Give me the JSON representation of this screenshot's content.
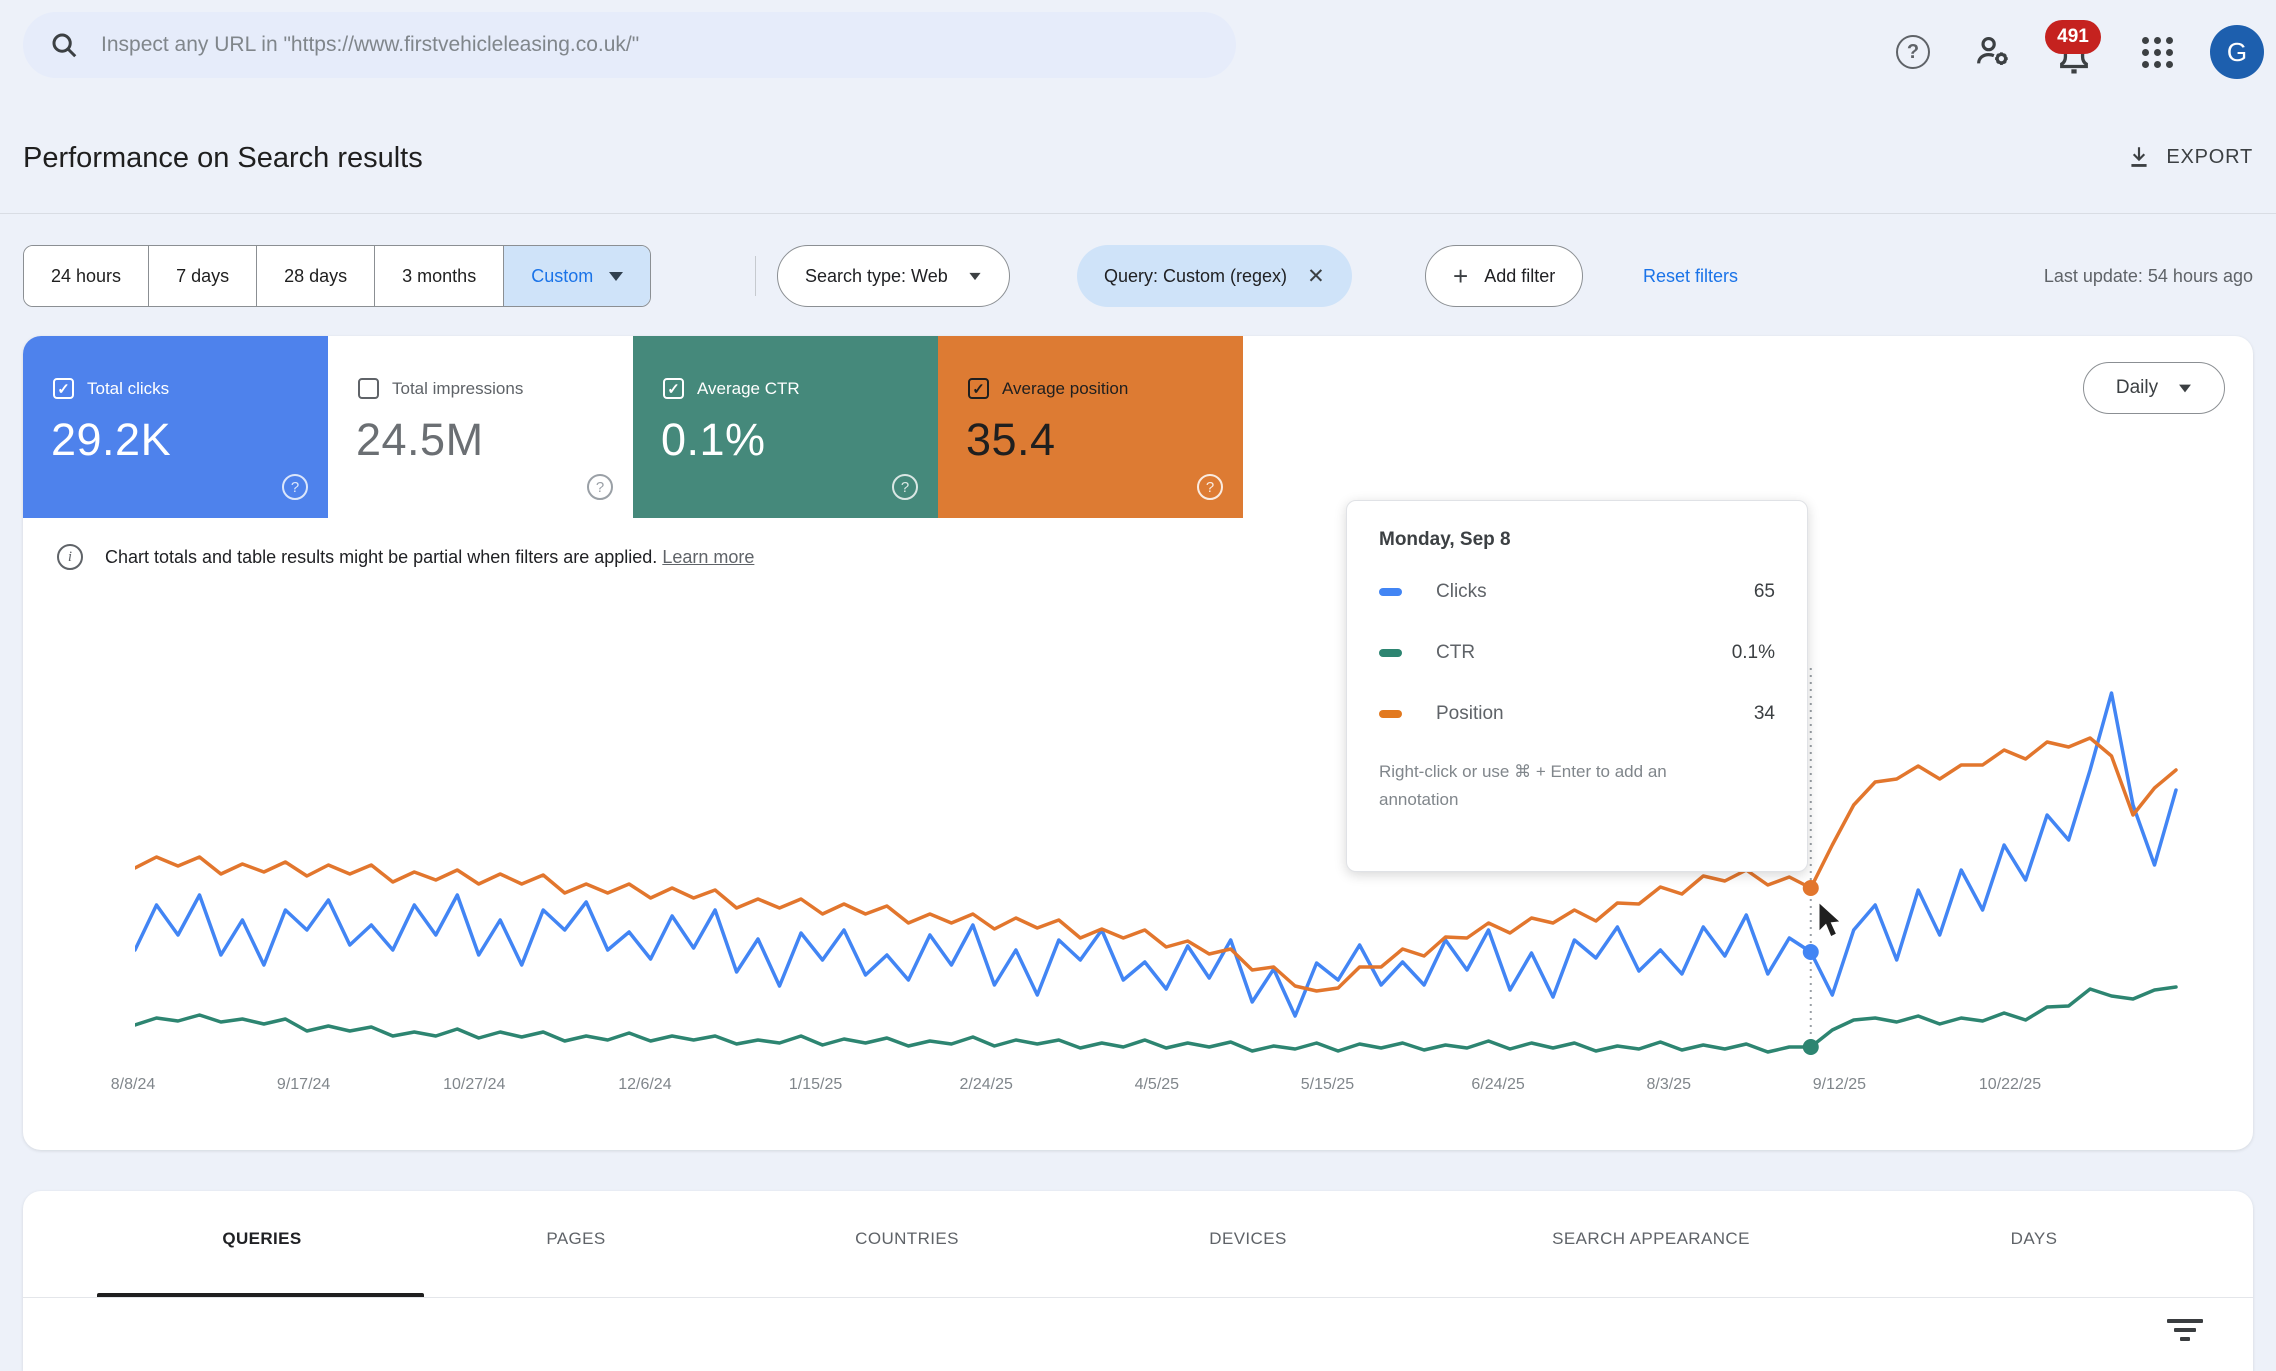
{
  "topbar": {
    "search_placeholder": "Inspect any URL in \"https://www.firstvehicleleasing.co.uk/\"",
    "notification_count": "491",
    "avatar_letter": "G"
  },
  "header": {
    "title": "Performance on Search results",
    "export_label": "EXPORT"
  },
  "filters": {
    "ranges": [
      "24 hours",
      "7 days",
      "28 days",
      "3 months"
    ],
    "custom_label": "Custom",
    "search_type_chip": "Search type: Web",
    "query_chip": "Query: Custom (regex)",
    "add_filter_label": "Add filter",
    "reset_label": "Reset filters",
    "last_update": "Last update: 54 hours ago"
  },
  "metrics": {
    "cards": [
      {
        "label": "Total clicks",
        "value": "29.2K",
        "checked": true,
        "bg": "#4e82ec",
        "fg": "#ffffff",
        "label_fg": "#ffffff",
        "help_fg": "rgba(255,255,255,0.8)"
      },
      {
        "label": "Total impressions",
        "value": "24.5M",
        "checked": false,
        "bg": "#ffffff",
        "fg": "#6b6f73",
        "label_fg": "#5f6368",
        "help_fg": "#9aa0a6"
      },
      {
        "label": "Average CTR",
        "value": "0.1%",
        "checked": true,
        "bg": "#45897b",
        "fg": "#ffffff",
        "label_fg": "#ffffff",
        "help_fg": "rgba(255,255,255,0.8)"
      },
      {
        "label": "Average position",
        "value": "35.4",
        "checked": true,
        "bg": "#dd7b33",
        "fg": "#1f1f1f",
        "label_fg": "#1f1f1f",
        "help_fg": "rgba(255,255,255,0.85)"
      }
    ]
  },
  "granularity": {
    "label": "Daily"
  },
  "notice": {
    "text": "Chart totals and table results might be partial when filters are applied.",
    "link_label": "Learn more"
  },
  "tooltip": {
    "title": "Monday, Sep 8",
    "rows": [
      {
        "label": "Clicks",
        "value": "65",
        "color": "#4285f4"
      },
      {
        "label": "CTR",
        "value": "0.1%",
        "color": "#2d8571"
      },
      {
        "label": "Position",
        "value": "34",
        "color": "#e2791f"
      }
    ],
    "footer": "Right-click or use ⌘ + Enter to add an annotation"
  },
  "chart_data": {
    "type": "line",
    "x_labels": [
      "8/8/24",
      "9/17/24",
      "10/27/24",
      "12/6/24",
      "1/15/25",
      "2/24/25",
      "4/5/25",
      "5/15/25",
      "6/24/25",
      "8/3/25",
      "9/12/25",
      "10/22/25"
    ],
    "grid": false,
    "legend_position": "none",
    "highlight_index": 78,
    "highlight_date": "Monday, Sep 8",
    "highlight_values": {
      "clicks": 65,
      "ctr_pct": 0.1,
      "position": 34
    },
    "series": [
      {
        "name": "Clicks",
        "color": "#4285f4",
        "values": [
          320,
          275,
          305,
          265,
          325,
          290,
          335,
          280,
          300,
          270,
          315,
          295,
          320,
          275,
          305,
          265,
          325,
          290,
          335,
          280,
          300,
          272,
          320,
          302,
          329,
          286,
          318,
          280,
          342,
          309,
          356,
          303,
          330,
          300,
          345,
          325,
          350,
          305,
          335,
          295,
          355,
          320,
          365,
          310,
          330,
          300,
          350,
          332,
          359,
          316,
          348,
          310,
          372,
          339,
          386,
          333,
          350,
          315,
          355,
          332,
          355,
          310,
          340,
          300,
          360,
          323,
          367,
          310,
          328,
          297,
          341,
          320,
          344,
          297,
          326,
          285,
          344,
          308,
          322,
          365,
          300,
          275,
          330,
          260,
          305,
          240,
          280,
          215,
          250,
          185,
          210,
          140,
          63,
          175,
          235,
          160
        ]
      },
      {
        "name": "CTR",
        "color": "#2d8571",
        "values": [
          395,
          388,
          391,
          385,
          392,
          389,
          394,
          389,
          401,
          396,
          401,
          397,
          406,
          402,
          406,
          399,
          408,
          402,
          407,
          402,
          411,
          406,
          410,
          403,
          411,
          406,
          410,
          406,
          414,
          410,
          413,
          406,
          415,
          409,
          413,
          408,
          416,
          411,
          414,
          407,
          416,
          410,
          414,
          410,
          418,
          413,
          417,
          410,
          418,
          413,
          417,
          412,
          421,
          416,
          419,
          413,
          421,
          414,
          418,
          413,
          420,
          415,
          418,
          411,
          419,
          413,
          418,
          413,
          421,
          416,
          419,
          412,
          420,
          415,
          419,
          414,
          422,
          417,
          417,
          400,
          390,
          388,
          392,
          386,
          394,
          388,
          391,
          383,
          390,
          377,
          376,
          359,
          366,
          369,
          360,
          357
        ]
      },
      {
        "name": "Position",
        "color": "#e2762d",
        "values": [
          238,
          227,
          236,
          227,
          244,
          234,
          242,
          232,
          246,
          235,
          244,
          235,
          252,
          242,
          250,
          240,
          254,
          244,
          254,
          245,
          263,
          254,
          263,
          254,
          268,
          258,
          268,
          260,
          278,
          269,
          278,
          269,
          284,
          274,
          284,
          276,
          293,
          284,
          293,
          284,
          299,
          288,
          298,
          290,
          308,
          299,
          308,
          300,
          317,
          311,
          324,
          319,
          340,
          337,
          356,
          361,
          358,
          337,
          337,
          319,
          326,
          307,
          308,
          293,
          303,
          288,
          293,
          280,
          291,
          273,
          274,
          257,
          264,
          246,
          251,
          240,
          255,
          247,
          258,
          215,
          175,
          152,
          149,
          136,
          149,
          135,
          135,
          120,
          129,
          112,
          117,
          108,
          126,
          185,
          158,
          140
        ]
      }
    ]
  },
  "tabs": {
    "items": [
      "QUERIES",
      "PAGES",
      "COUNTRIES",
      "DEVICES",
      "SEARCH APPEARANCE",
      "DAYS"
    ],
    "active": "QUERIES"
  }
}
